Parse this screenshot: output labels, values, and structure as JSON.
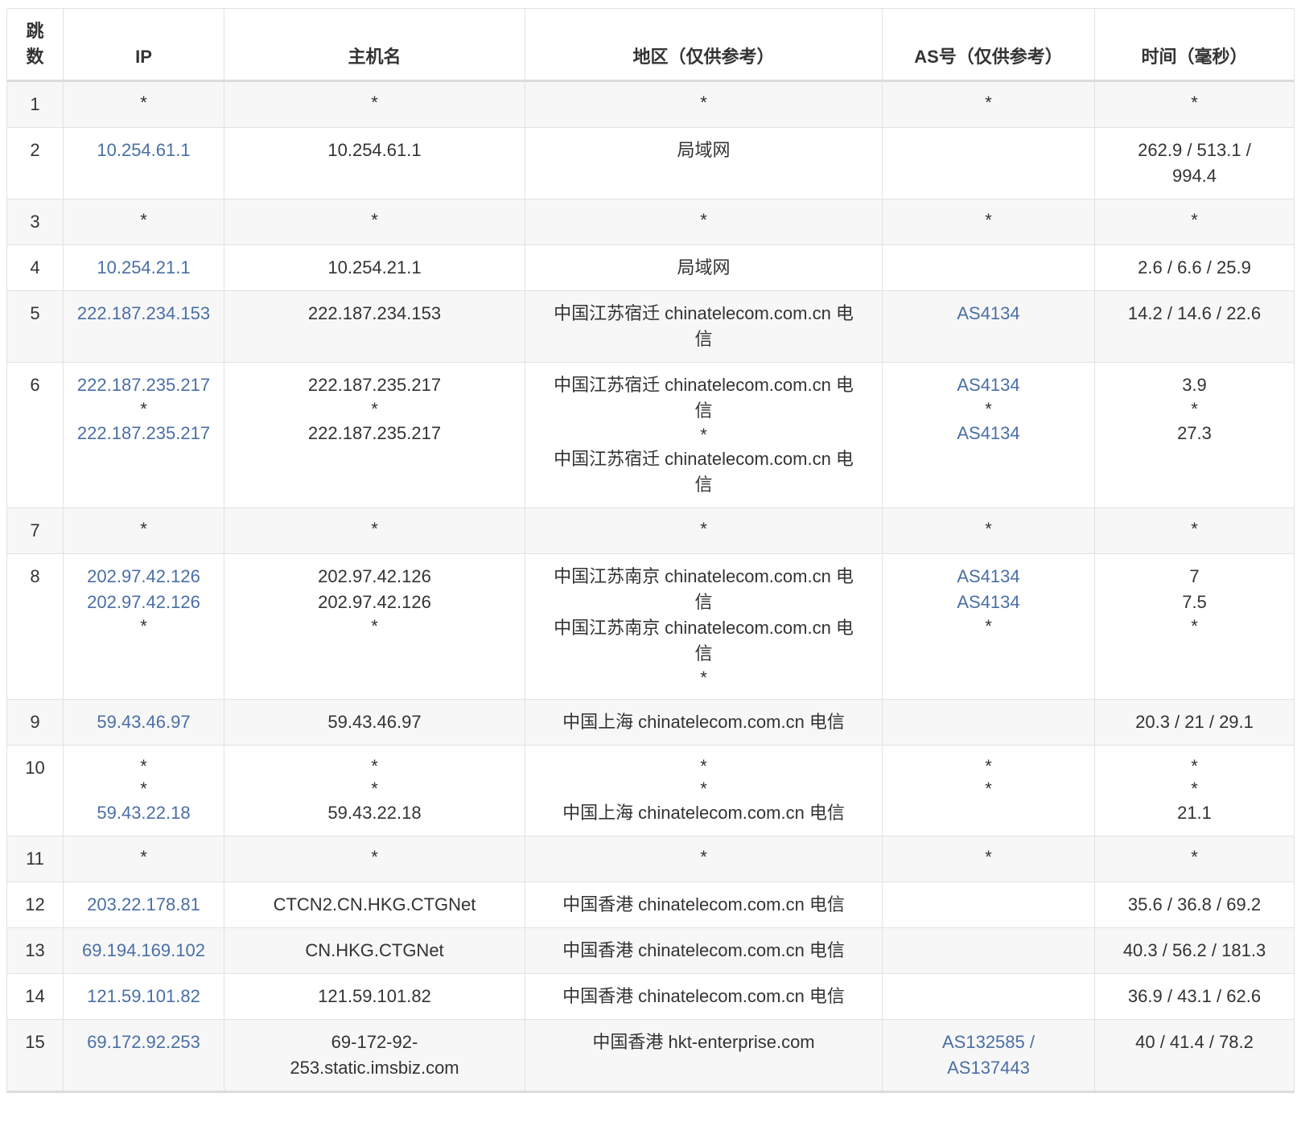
{
  "table": {
    "headers": {
      "hop": "跳\n数",
      "hop_line1": "跳",
      "hop_line2": "数",
      "ip": "IP",
      "hostname": "主机名",
      "location": "地区（仅供参考）",
      "asn": "AS号（仅供参考）",
      "time": "时间（毫秒）"
    },
    "rows": [
      {
        "hop": "1",
        "ip": [
          "*"
        ],
        "hostname": [
          "*"
        ],
        "location": [
          "*"
        ],
        "asn": [
          "*"
        ],
        "time": [
          "*"
        ]
      },
      {
        "hop": "2",
        "ip": [
          "10.254.61.1"
        ],
        "hostname": [
          "10.254.61.1"
        ],
        "location": [
          "局域网"
        ],
        "asn": [],
        "time": [
          "262.9 / 513.1 /",
          "994.4"
        ]
      },
      {
        "hop": "3",
        "ip": [
          "*"
        ],
        "hostname": [
          "*"
        ],
        "location": [
          "*"
        ],
        "asn": [
          "*"
        ],
        "time": [
          "*"
        ]
      },
      {
        "hop": "4",
        "ip": [
          "10.254.21.1"
        ],
        "hostname": [
          "10.254.21.1"
        ],
        "location": [
          "局域网"
        ],
        "asn": [],
        "time": [
          "2.6 / 6.6 / 25.9"
        ]
      },
      {
        "hop": "5",
        "ip": [
          "222.187.234.153"
        ],
        "hostname": [
          "222.187.234.153"
        ],
        "location": [
          "中国江苏宿迁 chinatelecom.com.cn 电",
          "信"
        ],
        "asn": [
          "AS4134"
        ],
        "time": [
          "14.2 / 14.6 / 22.6"
        ]
      },
      {
        "hop": "6",
        "ip": [
          "222.187.235.217",
          "*",
          "222.187.235.217"
        ],
        "hostname": [
          "222.187.235.217",
          "*",
          "222.187.235.217"
        ],
        "location": [
          "中国江苏宿迁 chinatelecom.com.cn 电",
          "信",
          "*",
          "中国江苏宿迁 chinatelecom.com.cn 电",
          "信"
        ],
        "asn": [
          "AS4134",
          "*",
          "AS4134"
        ],
        "time": [
          "3.9",
          "*",
          "27.3"
        ]
      },
      {
        "hop": "7",
        "ip": [
          "*"
        ],
        "hostname": [
          "*"
        ],
        "location": [
          "*"
        ],
        "asn": [
          "*"
        ],
        "time": [
          "*"
        ]
      },
      {
        "hop": "8",
        "ip": [
          "202.97.42.126",
          "202.97.42.126",
          "*"
        ],
        "hostname": [
          "202.97.42.126",
          "202.97.42.126",
          "*"
        ],
        "location": [
          "中国江苏南京 chinatelecom.com.cn 电",
          "信",
          "中国江苏南京 chinatelecom.com.cn 电",
          "信",
          "*"
        ],
        "asn": [
          "AS4134",
          "AS4134",
          "*"
        ],
        "time": [
          "7",
          "7.5",
          "*"
        ]
      },
      {
        "hop": "9",
        "ip": [
          "59.43.46.97"
        ],
        "hostname": [
          "59.43.46.97"
        ],
        "location": [
          "中国上海 chinatelecom.com.cn 电信"
        ],
        "asn": [],
        "time": [
          "20.3 / 21 / 29.1"
        ]
      },
      {
        "hop": "10",
        "ip": [
          "*",
          "*",
          "59.43.22.18"
        ],
        "hostname": [
          "*",
          "*",
          "59.43.22.18"
        ],
        "location": [
          "*",
          "*",
          "中国上海 chinatelecom.com.cn 电信"
        ],
        "asn": [
          "*",
          "*"
        ],
        "time": [
          "*",
          "*",
          "21.1"
        ]
      },
      {
        "hop": "11",
        "ip": [
          "*"
        ],
        "hostname": [
          "*"
        ],
        "location": [
          "*"
        ],
        "asn": [
          "*"
        ],
        "time": [
          "*"
        ]
      },
      {
        "hop": "12",
        "ip": [
          "203.22.178.81"
        ],
        "hostname": [
          "CTCN2.CN.HKG.CTGNet"
        ],
        "location": [
          "中国香港 chinatelecom.com.cn 电信"
        ],
        "asn": [],
        "time": [
          "35.6 / 36.8 / 69.2"
        ]
      },
      {
        "hop": "13",
        "ip": [
          "69.194.169.102"
        ],
        "hostname": [
          "CN.HKG.CTGNet"
        ],
        "location": [
          "中国香港 chinatelecom.com.cn 电信"
        ],
        "asn": [],
        "time": [
          "40.3 / 56.2 / 181.3"
        ]
      },
      {
        "hop": "14",
        "ip": [
          "121.59.101.82"
        ],
        "hostname": [
          "121.59.101.82"
        ],
        "location": [
          "中国香港 chinatelecom.com.cn 电信"
        ],
        "asn": [],
        "time": [
          "36.9 / 43.1 / 62.6"
        ]
      },
      {
        "hop": "15",
        "ip": [
          "69.172.92.253"
        ],
        "hostname": [
          "69-172-92-",
          "253.static.imsbiz.com"
        ],
        "location": [
          "中国香港 hkt-enterprise.com"
        ],
        "asn": [
          "AS132585 /",
          "AS137443"
        ],
        "time": [
          "40 / 41.4 / 78.2"
        ]
      }
    ]
  },
  "colors": {
    "link": "#4a6fa5",
    "text": "#333333",
    "stripe": "#f7f7f7",
    "border": "#e2e2e2"
  }
}
